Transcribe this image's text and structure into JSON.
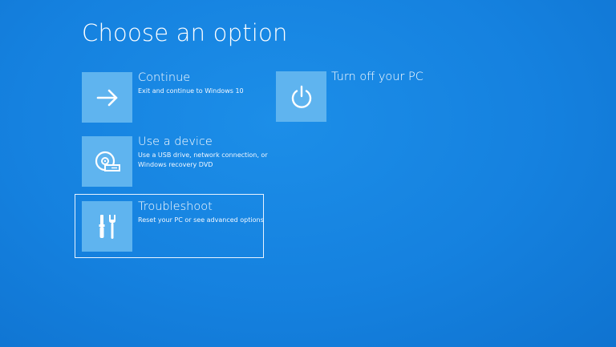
{
  "page": {
    "title": "Choose an option"
  },
  "options": [
    {
      "id": "continue",
      "label": "Continue",
      "description_lines": [
        "Exit and continue to Windows 10"
      ],
      "icon": "arrow-right-icon"
    },
    {
      "id": "use-a-device",
      "label": "Use a device",
      "description_lines": [
        "Use a USB drive, network connection, or",
        "Windows recovery DVD"
      ],
      "icon": "disc-drive-icon"
    },
    {
      "id": "troubleshoot",
      "label": "Troubleshoot",
      "description_lines": [
        "Reset your PC or see advanced options"
      ],
      "icon": "tools-icon",
      "selected": true
    },
    {
      "id": "turn-off",
      "label": "Turn off your PC",
      "description_lines": [],
      "icon": "power-icon"
    }
  ],
  "colors": {
    "background": "#1581df",
    "tile": "#5fb4ef",
    "text": "#ffffff",
    "selection_outline": "#e8f3ff"
  }
}
